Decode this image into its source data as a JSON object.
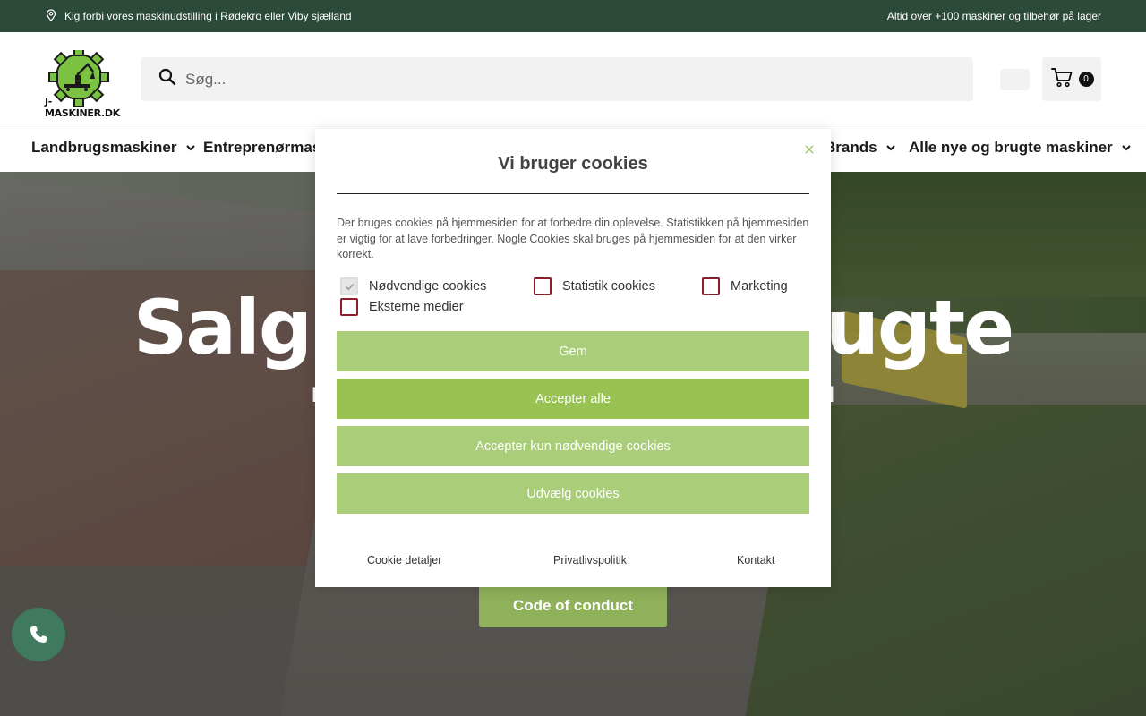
{
  "topbar": {
    "left_text": "Kig forbi vores maskinudstilling i Rødekro eller Viby sjælland",
    "right_text": "Altid over +100 maskiner og tilbehør på lager",
    "bg_color": "#2c4a3a"
  },
  "header": {
    "logo_text": "J-MASKINER.DK",
    "search_placeholder": "Søg...",
    "cart_count": "0"
  },
  "nav": {
    "items": [
      {
        "label": "Landbrugsmaskiner"
      },
      {
        "label": "Entreprenørmaskiner"
      },
      {
        "label": "Brands"
      },
      {
        "label": "Alle nye og brugte maskiner"
      }
    ]
  },
  "hero": {
    "title": "Salg af nye og brugte maskiner",
    "subtitle": "Din partner indenfor landbrug, entreprenør og fritid",
    "button_label": "Code of conduct"
  },
  "cookie_modal": {
    "title": "Vi bruger cookies",
    "text": "Der bruges cookies på hjemmesiden for at forbedre din oplevelse. Statistikken på hjemmesiden er vigtig for at lave forbedringer. Nogle Cookies skal bruges på hjemmesiden for at den virker korrekt.",
    "checkboxes": [
      {
        "label": "Nødvendige cookies",
        "checked": true,
        "disabled": true
      },
      {
        "label": "Statistik cookies",
        "checked": false
      },
      {
        "label": "Marketing",
        "checked": false
      },
      {
        "label": "Eksterne medier",
        "checked": false
      }
    ],
    "buttons": [
      {
        "label": "Gem"
      },
      {
        "label": "Accepter alle"
      },
      {
        "label": "Accepter kun nødvendige cookies"
      },
      {
        "label": "Udvælg cookies"
      }
    ],
    "links": [
      {
        "label": "Cookie detaljer"
      },
      {
        "label": "Privatlivspolitik"
      },
      {
        "label": "Kontakt"
      }
    ],
    "accent_color": "#98c252",
    "checkbox_color": "#8b1d2c"
  }
}
